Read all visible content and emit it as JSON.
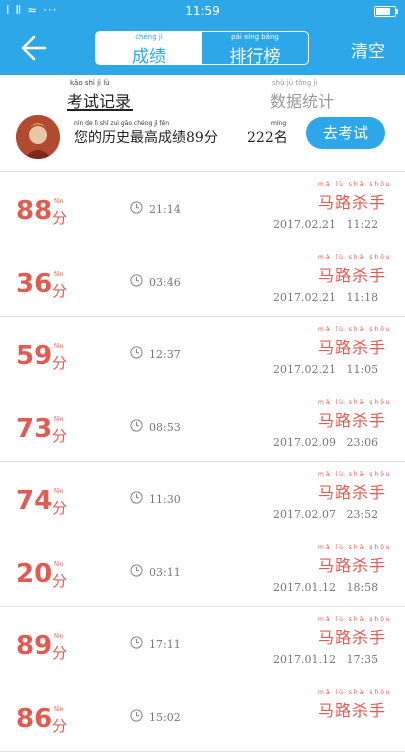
{
  "status_bar": {
    "left_icons": "Ⅰ Ⅱ ≈ ···",
    "time": "11:59"
  },
  "nav": {
    "tab_active": {
      "label": "成绩",
      "pinyin": "chéng  jì"
    },
    "tab_inactive": {
      "label": "排行榜",
      "pinyin": "pái  xíng  bǎng"
    },
    "clear_label": "清空"
  },
  "header": {
    "tab_records": {
      "label": "考试记录",
      "pinyin": "kǎo  shì  jì  lù"
    },
    "tab_stats": {
      "label": "数据统计",
      "pinyin": "shù  jù  tǒng  jì"
    },
    "best_pinyin": "nín  de  lì  shǐ  zuì  gāo  chéng  jì  fēn",
    "best_text": "您的历史最高成绩89分",
    "rank_pinyin": "míng",
    "rank_text": "222名",
    "exam_button": "去考试"
  },
  "record_labels": {
    "fen": "分",
    "fen_pinyin": "fēn",
    "user_pinyin": "mǎ  lù  shā  shǒu"
  },
  "records": [
    {
      "score": "88",
      "duration": "21:14",
      "user": "马路杀手",
      "datetime": "2017.02.21   11:22"
    },
    {
      "score": "36",
      "duration": "03:46",
      "user": "马路杀手",
      "datetime": "2017.02.21   11:18"
    },
    {
      "score": "59",
      "duration": "12:37",
      "user": "马路杀手",
      "datetime": "2017.02.21   11:05"
    },
    {
      "score": "73",
      "duration": "08:53",
      "user": "马路杀手",
      "datetime": "2017.02.09   23:06"
    },
    {
      "score": "74",
      "duration": "11:30",
      "user": "马路杀手",
      "datetime": "2017.02.07   23:52"
    },
    {
      "score": "20",
      "duration": "03:11",
      "user": "马路杀手",
      "datetime": "2017.01.12   18:58"
    },
    {
      "score": "89",
      "duration": "17:11",
      "user": "马路杀手",
      "datetime": "2017.01.12   17:35"
    },
    {
      "score": "86",
      "duration": "15:02",
      "user": "马路杀手",
      "datetime": ""
    }
  ]
}
